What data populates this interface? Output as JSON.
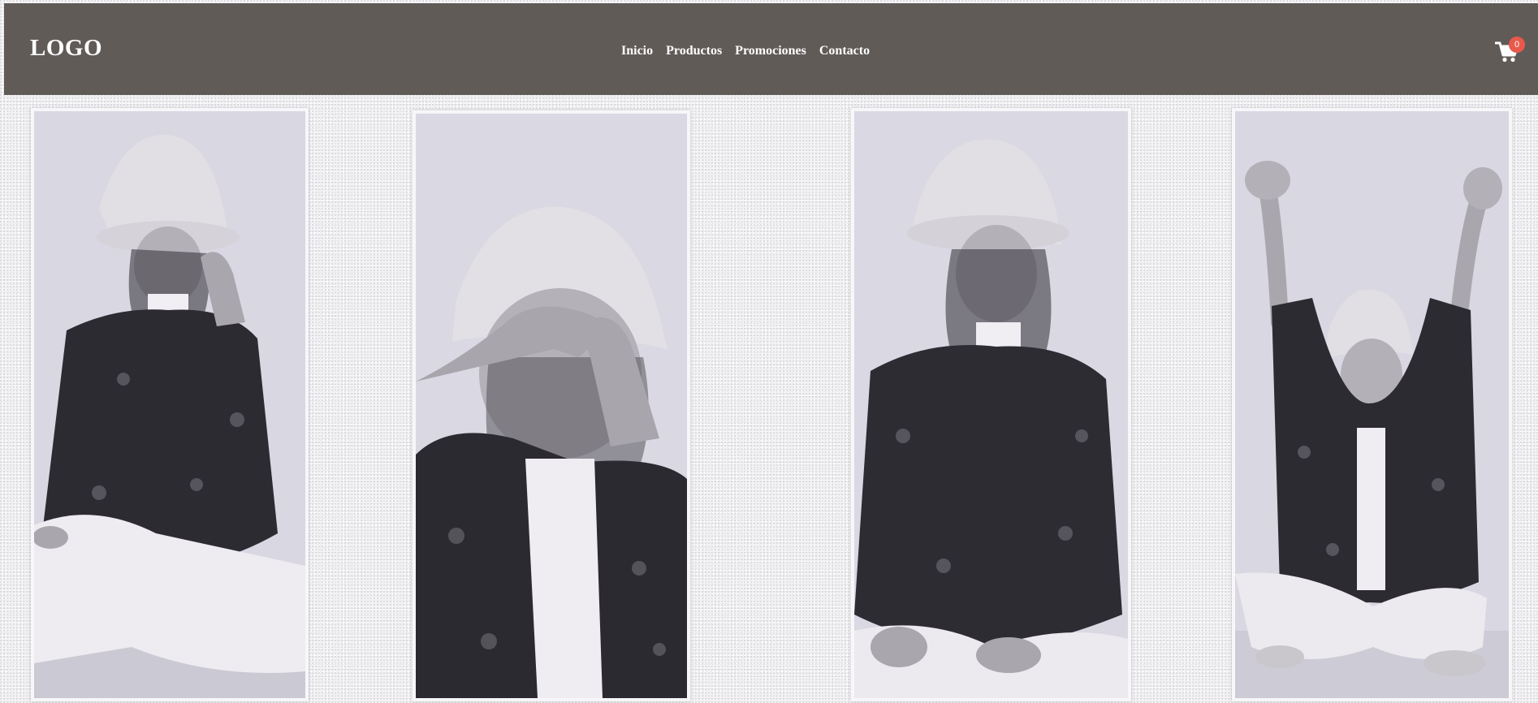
{
  "header": {
    "logo": "LOGO",
    "nav": [
      {
        "label": "Inicio"
      },
      {
        "label": "Productos"
      },
      {
        "label": "Promociones"
      },
      {
        "label": "Contacto"
      }
    ],
    "cart": {
      "icon": "shopping-cart-icon",
      "count": "0"
    }
  },
  "gallery": {
    "photos": [
      {
        "pose": "sitting-hand-on-hat"
      },
      {
        "pose": "heart-hands"
      },
      {
        "pose": "sitting-looking-aside"
      },
      {
        "pose": "arms-raised"
      }
    ]
  },
  "colors": {
    "navbar": "#615b58",
    "text": "#ffffff",
    "badge": "#e9594b",
    "background": "#f3f2f5",
    "photo_backdrop": "#d9d7e2",
    "jacket": "#2e2c33",
    "hat": "#e0dce2"
  }
}
